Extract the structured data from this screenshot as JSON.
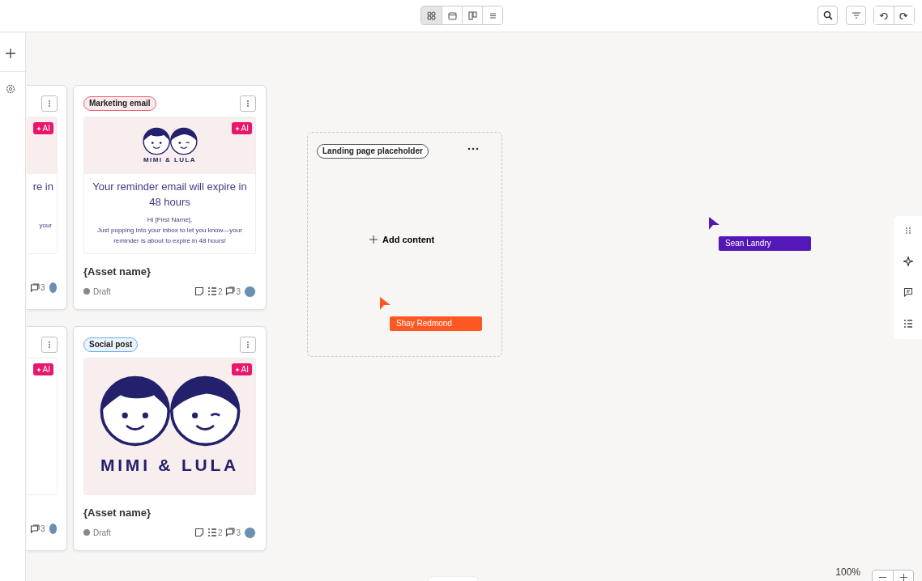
{
  "toolbar": {
    "view_modes": [
      {
        "kind": "grid",
        "selected": true
      },
      {
        "kind": "calendar",
        "selected": false
      },
      {
        "kind": "board",
        "selected": false
      },
      {
        "kind": "list",
        "selected": false
      }
    ]
  },
  "canvas": {
    "cards": [
      {
        "kind": "email",
        "partial": true,
        "ai_badge": "AI",
        "headline": "re in",
        "body": "your",
        "comments": "3"
      },
      {
        "kind": "email",
        "partial": false,
        "tag": {
          "label": "Marketing email",
          "color": "#e8616e"
        },
        "ai_badge": "AI",
        "logo_text": "MIMI & LULA",
        "headline": "Your reminder email will expire in 48 hours",
        "greeting": "Hi [First Name],",
        "body": "Just popping into your inbox to let you know—your reminder is about to expire in 48 hours!",
        "title": "{Asset name}",
        "status": "Draft",
        "checklist": "2",
        "comments": "3"
      },
      {
        "kind": "social",
        "partial": true,
        "ai_badge": "AI",
        "comments": "3"
      },
      {
        "kind": "social",
        "partial": false,
        "tag": {
          "label": "Social post",
          "color": "#6aaef0"
        },
        "ai_badge": "AI",
        "logo_text": "MIMI & LULA",
        "title": "{Asset name}",
        "status": "Draft",
        "checklist": "2",
        "comments": "3"
      }
    ],
    "placeholder": {
      "tag": "Landing page placeholder",
      "action": "Add content"
    },
    "cursors": [
      {
        "name": "Shay Redmond",
        "color": "#ff5722"
      },
      {
        "name": "Sean Landry",
        "color": "#5417b8"
      }
    ]
  },
  "zoom": {
    "reading": "100%"
  }
}
